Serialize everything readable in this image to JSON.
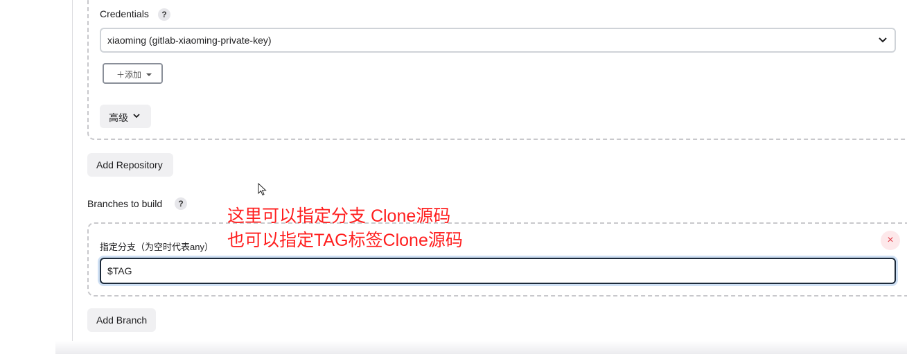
{
  "repository": {
    "credentials_label": "Credentials",
    "help_glyph": "?",
    "credentials_value": "xiaoming (gitlab-xiaoming-private-key)",
    "add_label": "＋添加",
    "advanced_label": "高级"
  },
  "add_repository_label": "Add Repository",
  "branches": {
    "section_label": "Branches to build",
    "help_glyph": "?",
    "branch_specifier_label": "指定分支（为空时代表any）",
    "branch_value": "$TAG",
    "delete_glyph": "×",
    "add_branch_label": "Add Branch"
  },
  "annotation": {
    "line1": "这里可以指定分支 Clone源码",
    "line2": "也可以指定TAG标签Clone源码",
    "color": "#ff1e1e"
  },
  "colors": {
    "focus_border": "#1c2a3a",
    "delete_bg": "#fde8ea",
    "delete_fg": "#e0404a"
  }
}
